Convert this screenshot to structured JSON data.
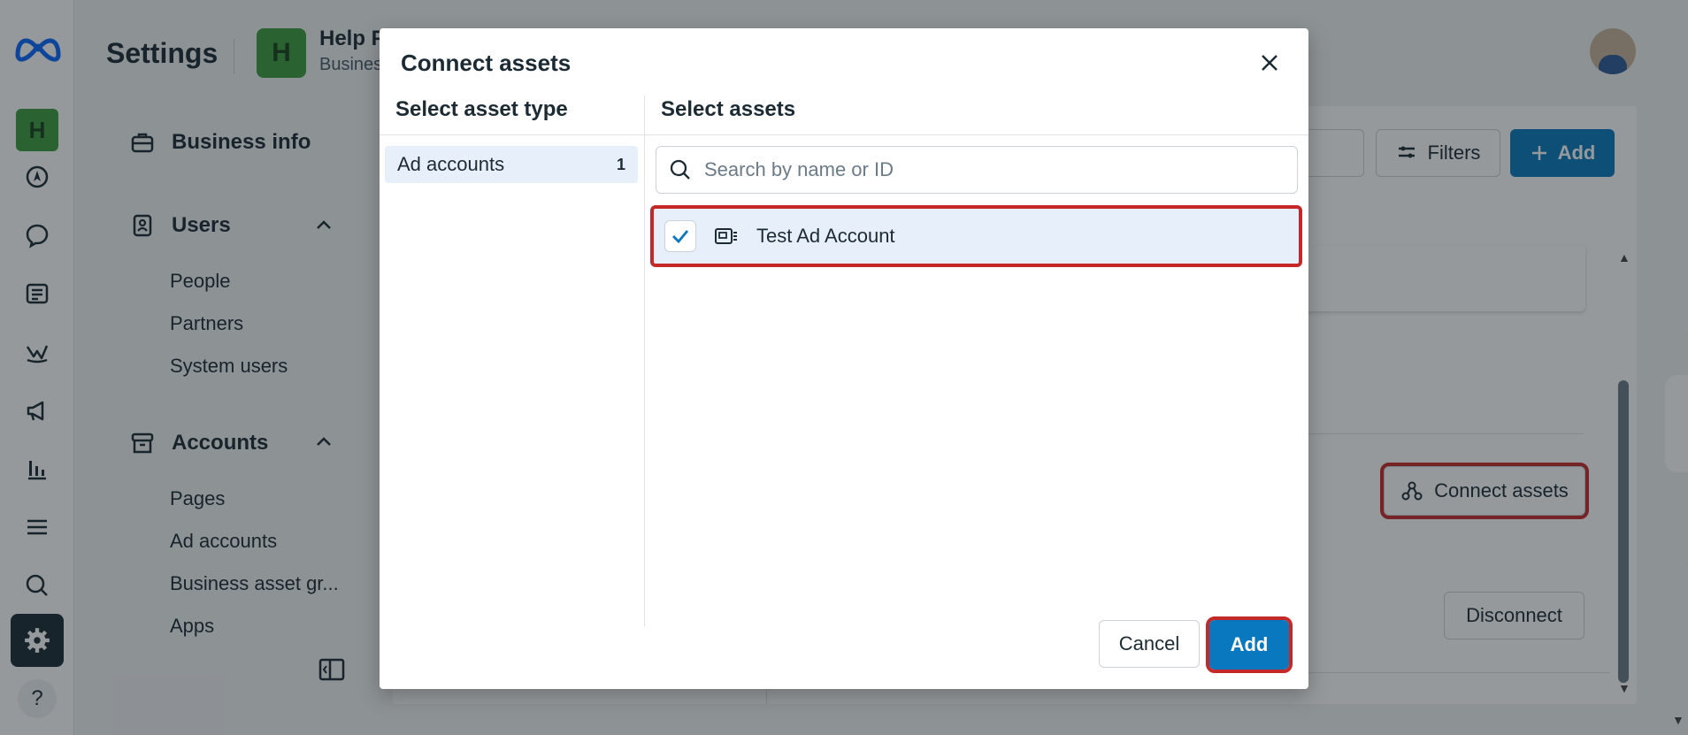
{
  "header": {
    "title": "Settings",
    "business_initial": "H",
    "business_name": "Help P",
    "business_subtitle": "Busines"
  },
  "rail": {
    "business_initial": "H",
    "help_label": "?",
    "icons": [
      "meta-logo-icon",
      "compass-icon",
      "chat-icon",
      "news-icon",
      "chart-icon",
      "megaphone-icon",
      "bar-chart-icon",
      "menu-icon",
      "search-icon",
      "gear-icon",
      "help-icon"
    ]
  },
  "nav": {
    "business_info": "Business info",
    "users": {
      "label": "Users",
      "items": [
        "People",
        "Partners",
        "System users"
      ]
    },
    "accounts": {
      "label": "Accounts",
      "items": [
        "Pages",
        "Ad accounts",
        "Business asset gr...",
        "Apps"
      ]
    }
  },
  "background": {
    "filters_label": "Filters",
    "add_label": "Add",
    "connect_assets_label": "Connect assets",
    "disconnect_label": "Disconnect"
  },
  "modal": {
    "title": "Connect assets",
    "asset_type_heading": "Select asset type",
    "assets_heading": "Select assets",
    "asset_types": [
      {
        "label": "Ad accounts",
        "count": "1"
      }
    ],
    "search_placeholder": "Search by name or ID",
    "assets": [
      {
        "name": "Test Ad Account",
        "checked": true
      }
    ],
    "cancel_label": "Cancel",
    "add_label": "Add"
  },
  "colors": {
    "accent": "#0a78be",
    "highlight_outline": "#c62828",
    "selected_bg": "#e7f0fa",
    "business_green": "#3f9b3f"
  }
}
